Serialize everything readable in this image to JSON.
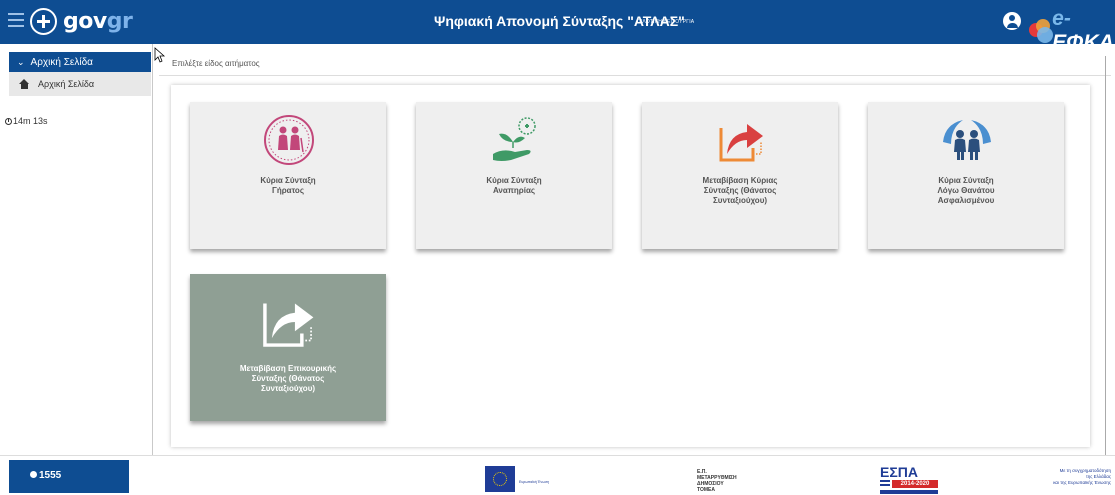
{
  "header": {
    "logo_text_gov": "gov",
    "logo_text_gr": "gr",
    "title": "Ψηφιακή Απονομή Σύνταξης \"ΑΤΛΑΣ\"",
    "subtitle": "ΠΙΛΟΤΙΚΗ ΛΕΙΤΟΥΡΓΙΑ",
    "efka_prefix": "e-",
    "efka_name": "ΕΦΚΑ",
    "brand_color": "#0e4d92"
  },
  "sidebar": {
    "section_label": "Αρχική Σελίδα",
    "items": [
      {
        "label": "Αρχική Σελίδα",
        "icon": "home-icon"
      }
    ],
    "timer": "14m 13s"
  },
  "main": {
    "breadcrumb": "Επιλέξτε είδος αιτήματος",
    "cards": [
      {
        "label": "Κύρια Σύνταξη\nΓήρατος",
        "icon": "elderly-couple-icon"
      },
      {
        "label": "Κύρια Σύνταξη\nΑναπηρίας",
        "icon": "hand-plant-icon"
      },
      {
        "label": "Μεταβίβαση Κύριας\nΣύνταξης (Θάνατος\nΣυνταξιούχου)",
        "icon": "transfer-arrow-icon"
      },
      {
        "label": "Κύρια Σύνταξη\nΛόγω Θανάτου\nΑσφαλισμένου",
        "icon": "family-hands-icon"
      },
      {
        "label": "Μεταβίβαση Επικουρικής\nΣύνταξης (Θάνατος\nΣυνταξιούχου)",
        "icon": "transfer-arrow-icon"
      }
    ]
  },
  "footer": {
    "phone": "1555",
    "eu_text": "Ευρωπαϊκή Ένωση",
    "reform_prefix": "Ε.Π.",
    "reform_line1": "ΜΕΤΑΡΡΥΘΜΙΣΗ",
    "reform_line2": "ΔΗΜΟΣΙΟΥ",
    "reform_line3": "ΤΟΜΕΑ",
    "espa": "ΕΣΠΑ",
    "espa_years": "2014-2020",
    "cofund": "Με τη συγχρηματοδότηση\nτης Ελλάδας\nκαι της Ευρωπαϊκής Ένωσης"
  }
}
